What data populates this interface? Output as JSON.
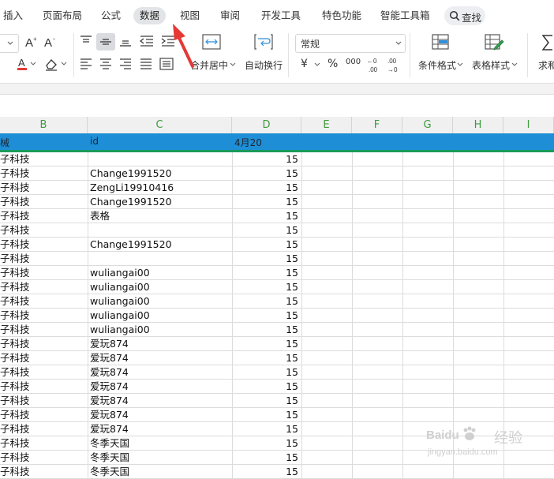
{
  "menu": {
    "tabs": [
      "插入",
      "页面布局",
      "公式",
      "数据",
      "视图",
      "审阅",
      "开发工具",
      "特色功能",
      "智能工具箱"
    ],
    "active_tab": "数据",
    "search_label": "查找"
  },
  "ribbon": {
    "number_format": "常规",
    "merge_center": "合并居中",
    "wrap_text": "自动换行",
    "conditional_format": "条件格式",
    "table_style": "表格样式",
    "sum": "求和",
    "currency_symbol": "¥",
    "percent_symbol": "%",
    "thousands_symbol": "000"
  },
  "sheet": {
    "columns": [
      "B",
      "C",
      "D",
      "E",
      "F",
      "G",
      "H",
      "I"
    ],
    "header_row": {
      "b": "械",
      "c": "id",
      "d": "4月20"
    },
    "rows": [
      {
        "b": "子科技",
        "c": "",
        "d": "15"
      },
      {
        "b": "子科技",
        "c": "Change1991520",
        "d": "15"
      },
      {
        "b": "子科技",
        "c": "ZengLi19910416",
        "d": "15"
      },
      {
        "b": "子科技",
        "c": "Change1991520",
        "d": "15"
      },
      {
        "b": "子科技",
        "c": "表格",
        "d": "15"
      },
      {
        "b": "子科技",
        "c": "",
        "d": "15"
      },
      {
        "b": "子科技",
        "c": "Change1991520",
        "d": "15"
      },
      {
        "b": "子科技",
        "c": "",
        "d": "15"
      },
      {
        "b": "子科技",
        "c": "wuliangai00",
        "d": "15"
      },
      {
        "b": "子科技",
        "c": "wuliangai00",
        "d": "15"
      },
      {
        "b": "子科技",
        "c": "wuliangai00",
        "d": "15"
      },
      {
        "b": "子科技",
        "c": "wuliangai00",
        "d": "15"
      },
      {
        "b": "子科技",
        "c": "wuliangai00",
        "d": "15"
      },
      {
        "b": "子科技",
        "c": "爱玩874",
        "d": "15"
      },
      {
        "b": "子科技",
        "c": "爱玩874",
        "d": "15"
      },
      {
        "b": "子科技",
        "c": "爱玩874",
        "d": "15"
      },
      {
        "b": "子科技",
        "c": "爱玩874",
        "d": "15"
      },
      {
        "b": "子科技",
        "c": "爱玩874",
        "d": "15"
      },
      {
        "b": "子科技",
        "c": "爱玩874",
        "d": "15"
      },
      {
        "b": "子科技",
        "c": "爱玩874",
        "d": "15"
      },
      {
        "b": "子科技",
        "c": "冬季天国",
        "d": "15"
      },
      {
        "b": "子科技",
        "c": "冬季天国",
        "d": "15"
      },
      {
        "b": "子科技",
        "c": "冬季天国",
        "d": "15"
      }
    ]
  },
  "watermark": {
    "brand": "Baidu",
    "sub": "经验",
    "url": "jingyan.baidu.com"
  },
  "colors": {
    "header_fill": "#1e8fd6",
    "header_border": "#1a9a5a",
    "column_letter": "#3f9a3f",
    "annotation_arrow": "#e53935"
  }
}
